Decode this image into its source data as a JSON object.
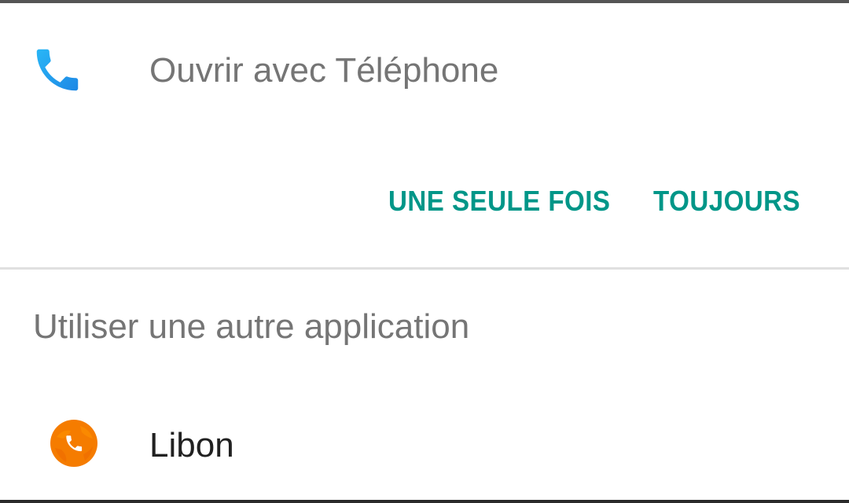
{
  "dialog": {
    "open_with_title": "Ouvrir avec Téléphone",
    "default_app_icon": "phone-icon",
    "buttons": {
      "just_once": "UNE SEULE FOIS",
      "always": "TOUJOURS"
    },
    "other_apps_heading": "Utiliser une autre application",
    "apps": [
      {
        "label": "Libon",
        "icon": "libon-app-icon"
      }
    ]
  },
  "colors": {
    "accent": "#009688",
    "phone_icon": "#1E88E5",
    "libon_icon": "#F57C00",
    "secondary_text": "#757575",
    "primary_text": "#212121",
    "divider": "#E0E0E0"
  }
}
